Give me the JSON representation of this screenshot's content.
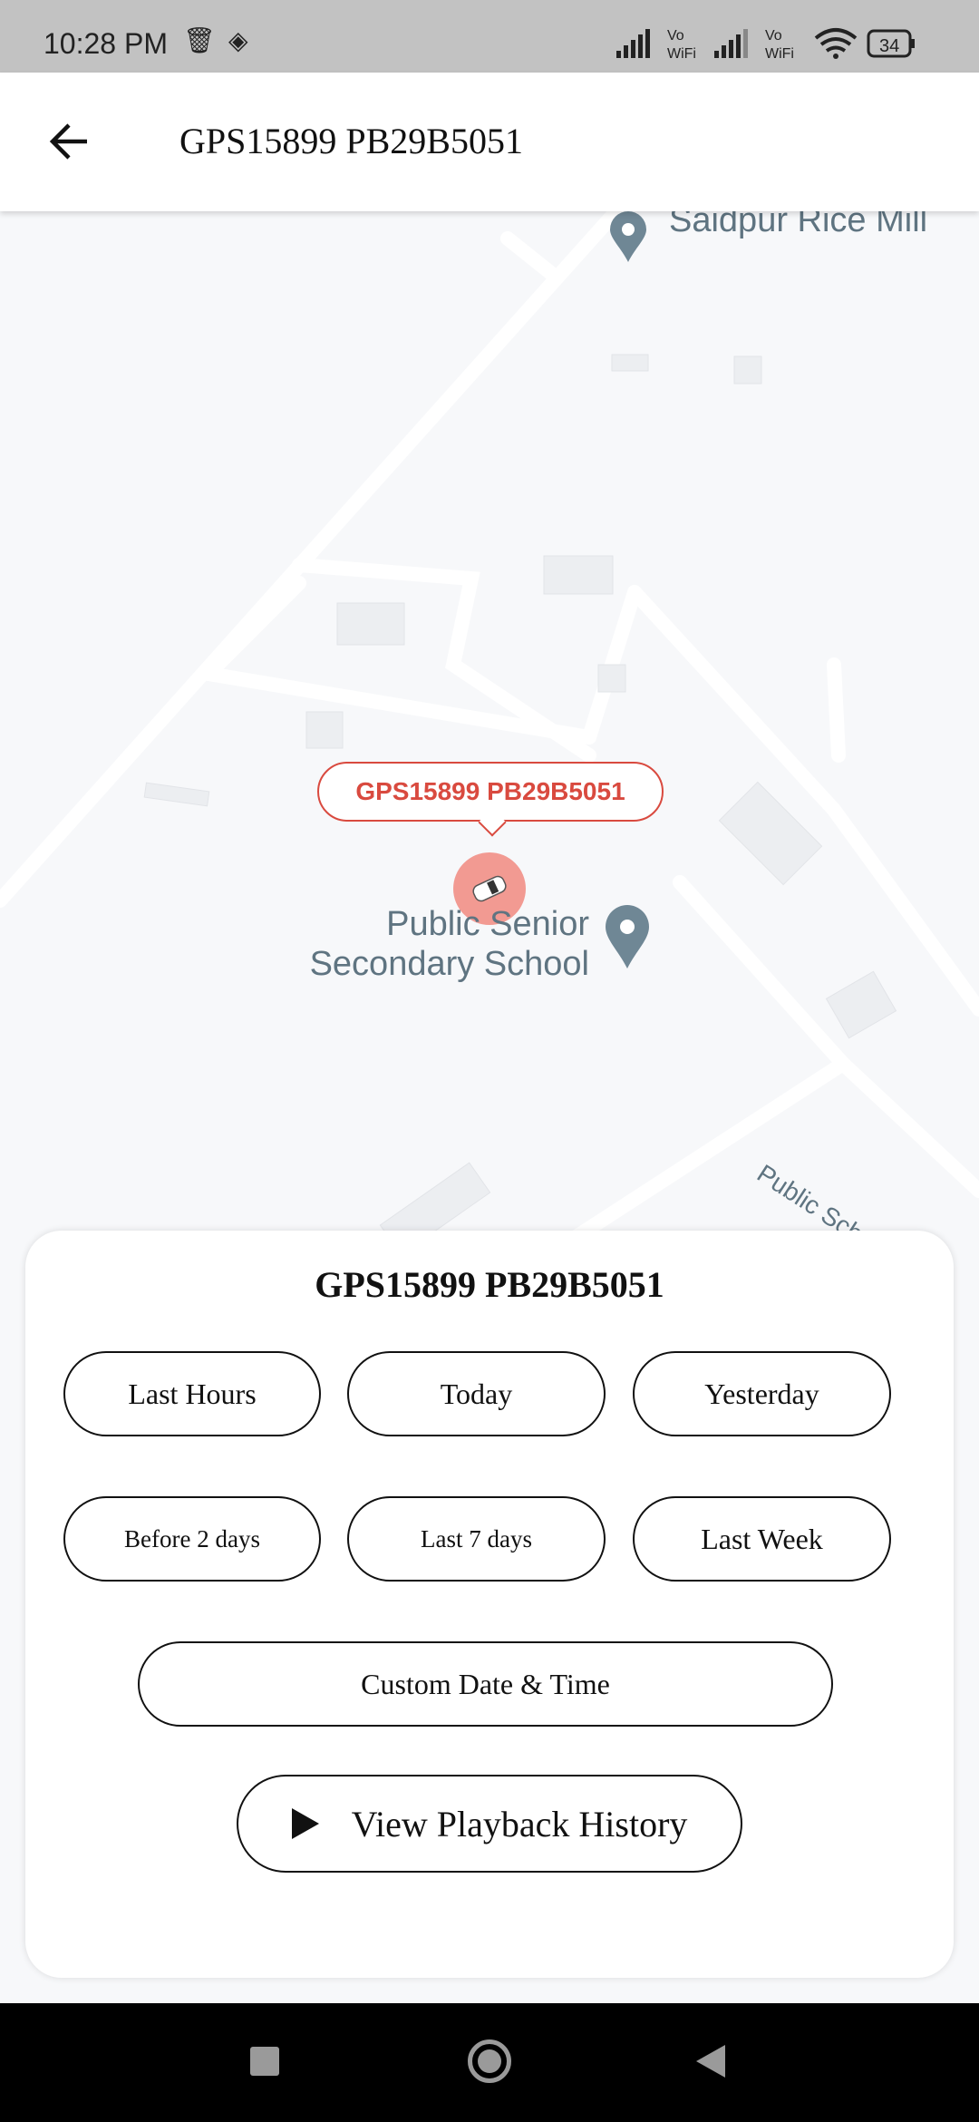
{
  "status_bar": {
    "time": "10:28 PM",
    "battery": "34",
    "network_labels": [
      "Vo WiFi",
      "Vo WiFi"
    ],
    "icons": [
      "trash-icon",
      "layers-icon",
      "signal-icon",
      "signal-icon",
      "wifi-icon",
      "battery-icon"
    ]
  },
  "app_bar": {
    "title": "GPS15899 PB29B5051",
    "back_icon": "arrow-left-icon"
  },
  "map": {
    "vehicle_label": "GPS15899 PB29B5051",
    "pois": [
      {
        "line1": "Public Senior",
        "line2": "Secondary School"
      },
      {
        "line1": "Saidpur Rice Mill"
      }
    ],
    "road_label": "Public Scho",
    "marker_color": "#f08278",
    "accent": "#d94a3f"
  },
  "sheet": {
    "title": "GPS15899 PB29B5051",
    "buttons": [
      "Last Hours",
      "Today",
      "Yesterday",
      "Before 2 days",
      "Last 7 days",
      "Last Week"
    ],
    "custom": "Custom Date & Time",
    "playback": "View Playback History"
  },
  "nav_bar": {
    "icons": [
      "recents-square-icon",
      "home-circle-icon",
      "back-triangle-icon"
    ]
  }
}
